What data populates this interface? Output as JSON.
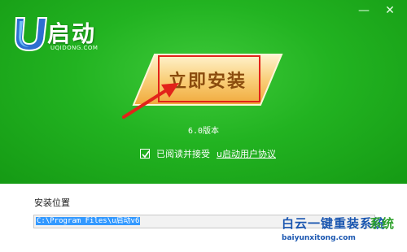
{
  "window": {
    "minimize_label": "—",
    "close_label": "✕"
  },
  "logo": {
    "brand": "启动",
    "domain": "UQIDONG.COM",
    "mark_icon": "u-logo-icon"
  },
  "install": {
    "button_label": "立即安装"
  },
  "version": "6.0版本",
  "agreement": {
    "checked": true,
    "text": "已阅读并接受",
    "link_label": "u启动用户协议"
  },
  "install_path": {
    "label": "安装位置",
    "value": "C:\\Program Files\\u启动v6"
  },
  "watermark": {
    "text": "白云一键重装系统",
    "url": "baiyunxitong.com",
    "logo_text": "系统"
  },
  "colors": {
    "green_bg": "#22b321",
    "button_orange": "#f7c873",
    "highlight_red": "#e2231a",
    "selection_blue": "#3399ff"
  }
}
